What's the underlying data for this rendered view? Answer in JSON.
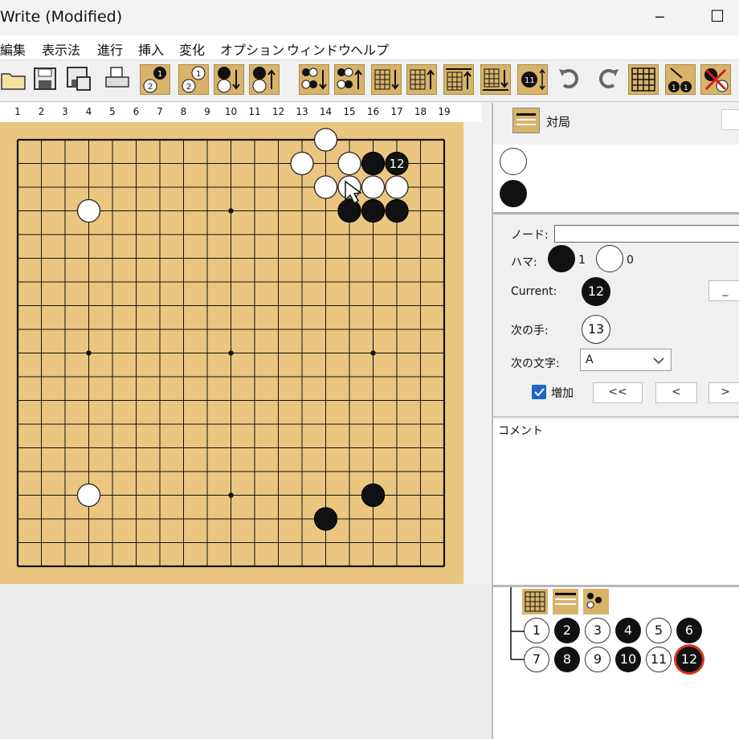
{
  "window": {
    "title": "Write (Modified)",
    "minimize": "‒",
    "maximize": "☐"
  },
  "menu": [
    "編集",
    "表示法",
    "進行",
    "挿入",
    "変化",
    "オプション",
    "ウィンドウ",
    "ヘルプ"
  ],
  "toolbar": {
    "buttons": [
      "open-icon",
      "save-icon",
      "save-as-icon",
      "print-icon",
      "move-1-icon",
      "move-2-icon",
      "move-3-icon",
      "move-4-icon",
      "next-moves-icon",
      "prev-moves-icon",
      "first-line-icon",
      "last-line-icon",
      "grid-down-icon",
      "grid-up-icon",
      "grid-top-icon",
      "grid-bottom-icon",
      "number-toggle-icon",
      "undo-icon",
      "redo-icon",
      "board-grid-icon",
      "auto-number-icon",
      "delete-stone-icon"
    ]
  },
  "board": {
    "column_numbers": [
      "1",
      "2",
      "3",
      "4",
      "5",
      "6",
      "7",
      "8",
      "9",
      "10",
      "11",
      "12",
      "13",
      "14",
      "15",
      "16",
      "17",
      "18",
      "19"
    ],
    "stones": [
      {
        "color": "white",
        "col": 14,
        "row": 1
      },
      {
        "color": "white",
        "col": 13,
        "row": 2
      },
      {
        "color": "white",
        "col": 15,
        "row": 2
      },
      {
        "color": "black",
        "col": 16,
        "row": 2
      },
      {
        "color": "black",
        "col": 17,
        "row": 2,
        "label": "12"
      },
      {
        "color": "white",
        "col": 14,
        "row": 3
      },
      {
        "color": "white",
        "col": 15,
        "row": 3
      },
      {
        "color": "white",
        "col": 16,
        "row": 3
      },
      {
        "color": "white",
        "col": 17,
        "row": 3
      },
      {
        "color": "black",
        "col": 15,
        "row": 4
      },
      {
        "color": "black",
        "col": 16,
        "row": 4
      },
      {
        "color": "black",
        "col": 17,
        "row": 4
      },
      {
        "color": "white",
        "col": 4,
        "row": 4
      },
      {
        "color": "white",
        "col": 4,
        "row": 16
      },
      {
        "color": "black",
        "col": 16,
        "row": 16
      },
      {
        "color": "black",
        "col": 14,
        "row": 17
      }
    ]
  },
  "game_panel": {
    "title": "対局"
  },
  "info": {
    "node_label": "ノード:",
    "node_value": "",
    "captures_label": "ハマ:",
    "black_captures": "1",
    "white_captures": "0"
  },
  "status": {
    "current_label": "Current:",
    "current_value": "12",
    "next_move_label": "次の手:",
    "next_move_value": "13",
    "next_char_label": "次の文字:",
    "next_char_value": "A",
    "increment_label": "増加",
    "increment_checked": true,
    "btn_first": "<<",
    "btn_prev": "<",
    "btn_next": ">",
    "btn_more": "_"
  },
  "comment": {
    "label": "コメント",
    "text": ""
  },
  "tree": {
    "moves": [
      {
        "n": "1",
        "color": "white"
      },
      {
        "n": "2",
        "color": "black"
      },
      {
        "n": "3",
        "color": "white"
      },
      {
        "n": "4",
        "color": "black"
      },
      {
        "n": "5",
        "color": "white"
      },
      {
        "n": "6",
        "color": "black"
      },
      {
        "n": "7",
        "color": "white"
      },
      {
        "n": "8",
        "color": "black"
      },
      {
        "n": "9",
        "color": "white"
      },
      {
        "n": "10",
        "color": "black"
      },
      {
        "n": "11",
        "color": "white"
      },
      {
        "n": "12",
        "color": "black",
        "current": true
      }
    ]
  }
}
